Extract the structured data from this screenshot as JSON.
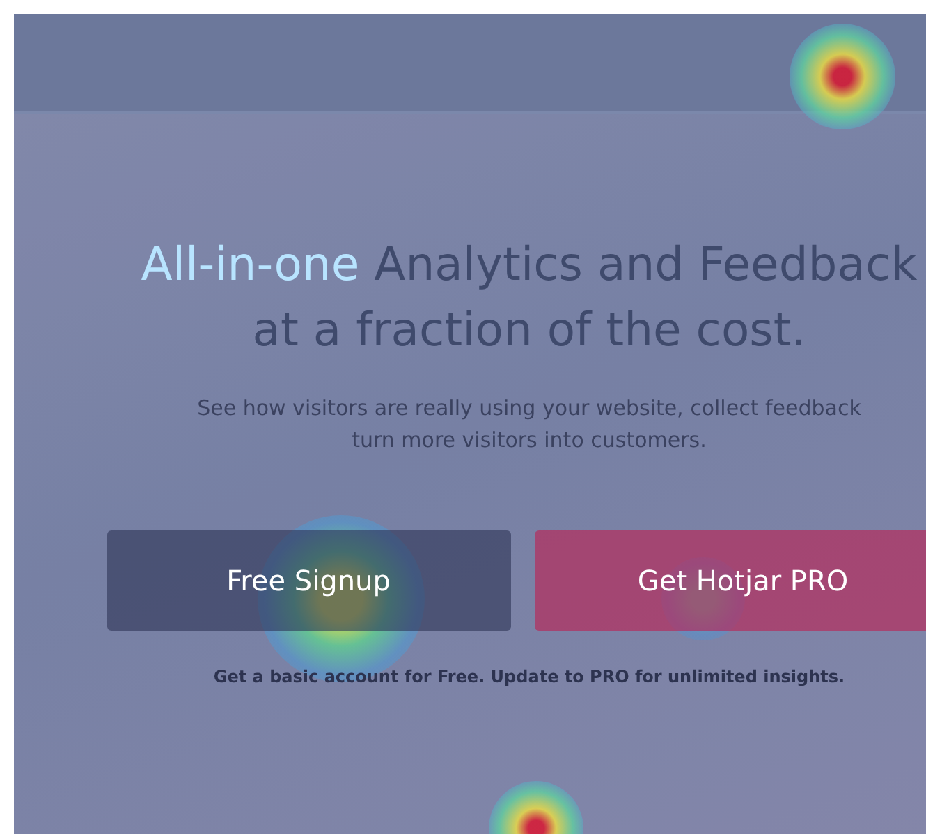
{
  "hero": {
    "heading_highlight": "All-in-one",
    "heading_rest": " Analytics and Feedback",
    "subheading": "at a fraction of the cost.",
    "text_line_1": "See how visitors are really using your website, collect feedback",
    "text_line_2": "turn more visitors into customers."
  },
  "buttons": [
    {
      "label": "Free Signup",
      "kind": "primary"
    },
    {
      "label": "Get Hotjar PRO",
      "kind": "pro"
    }
  ],
  "note": "Get a basic account for Free. Update to PRO for unlimited insights."
}
